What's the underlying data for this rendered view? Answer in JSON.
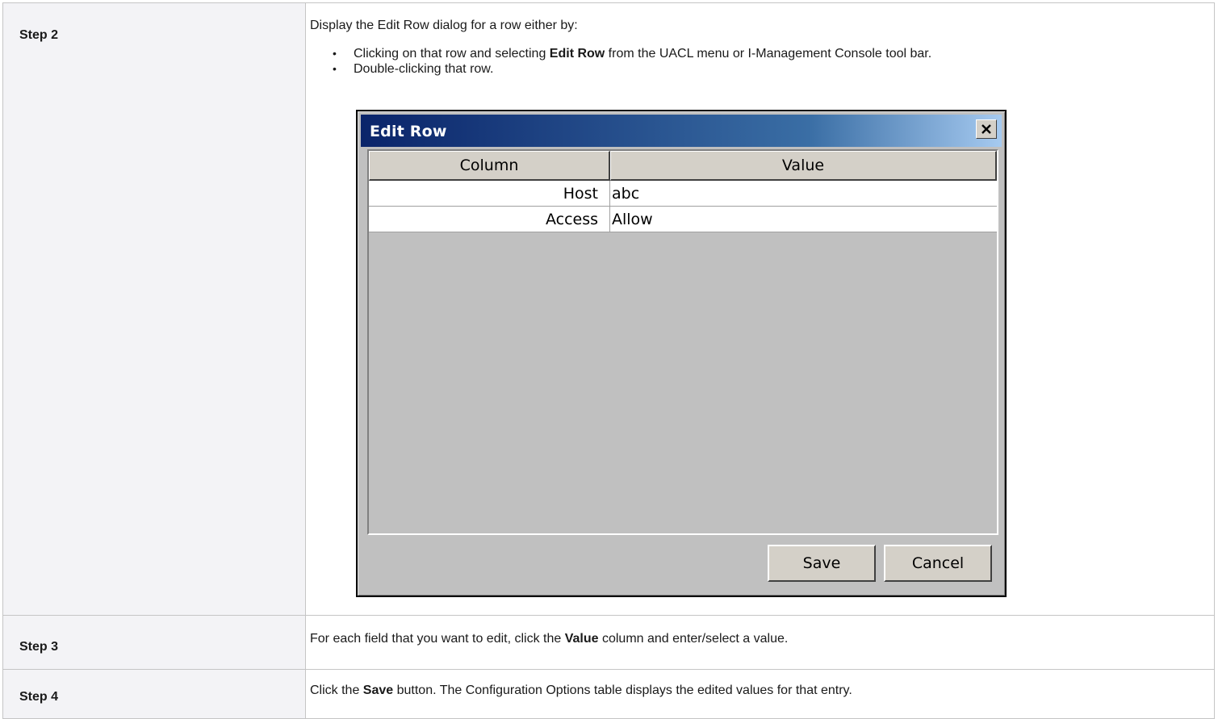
{
  "steps": [
    {
      "label": "Step 2",
      "intro": "Display the Edit Row dialog for a row either by:",
      "bullets": [
        {
          "before": "Clicking on that row and selecting ",
          "bold": "Edit Row",
          "after": " from the UACL menu or I-Management Console tool bar."
        },
        {
          "text": "Double-clicking that row."
        }
      ]
    },
    {
      "label": "Step 3",
      "before": "For each field that you want to edit, click the ",
      "bold": "Value",
      "after": " column and enter/select a value."
    },
    {
      "label": "Step 4",
      "before": "Click the ",
      "bold": "Save",
      "after": " button. The Configuration Options table displays the edited values for that entry."
    }
  ],
  "dialog": {
    "title": "Edit Row",
    "columns": [
      "Column",
      "Value"
    ],
    "rows": [
      {
        "column": "Host",
        "value": "abc"
      },
      {
        "column": "Access",
        "value": "Allow"
      }
    ],
    "save_label": "Save",
    "cancel_label": "Cancel",
    "close_icon": "close-icon"
  },
  "bullet_glyph": "•"
}
